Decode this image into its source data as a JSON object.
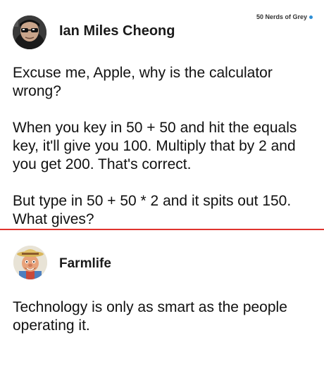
{
  "watermark": {
    "text": "50 Nerds of Grey",
    "dot_color": "#2e8fd6"
  },
  "divider_color": "#e0332d",
  "posts": [
    {
      "author": "Ian Miles Cheong",
      "avatar_icon": "profile-photo-sunglasses",
      "paragraphs": [
        "Excuse me, Apple, why is the calculator wrong?",
        "When you key in 50 + 50 and hit the equals key, it'll give you 100. Multiply that by 2 and you get 200. That's correct.",
        "But type in 50 + 50 * 2 and it spits out 150. What gives?"
      ]
    },
    {
      "author": "Farmlife",
      "avatar_icon": "cartoon-farmer-avatar",
      "paragraphs": [
        "Technology is only as smart as the people operating it."
      ]
    }
  ]
}
